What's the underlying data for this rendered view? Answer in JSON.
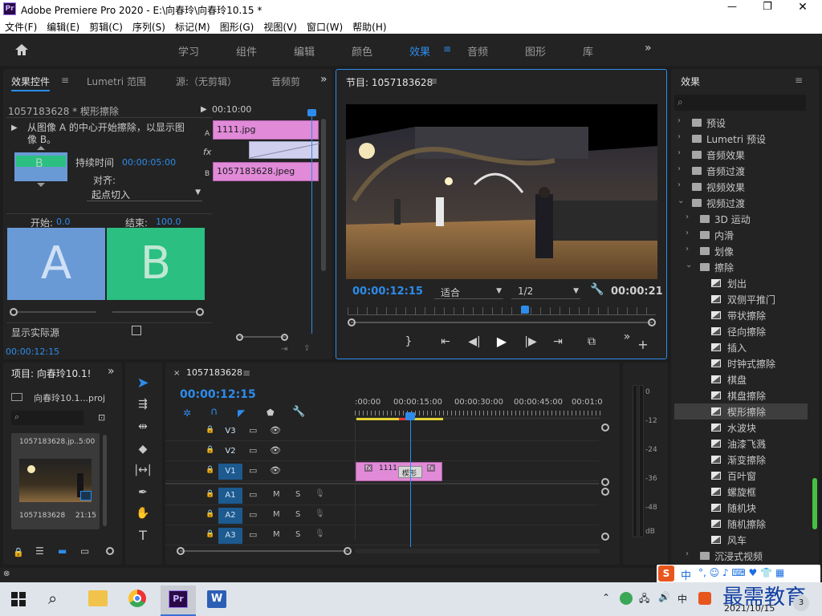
{
  "titlebar": {
    "app_icon": "Pr",
    "title": "Adobe Premiere Pro 2020 - E:\\向春玲\\向春玲10.15 *",
    "min": "—",
    "max": "❐",
    "close": "✕"
  },
  "menu": [
    "文件(F)",
    "编辑(E)",
    "剪辑(C)",
    "序列(S)",
    "标记(M)",
    "图形(G)",
    "视图(V)",
    "窗口(W)",
    "帮助(H)"
  ],
  "workspaces": [
    "学习",
    "组件",
    "编辑",
    "颜色",
    "效果",
    "音频",
    "图形",
    "库"
  ],
  "active_workspace": "效果",
  "effect_controls": {
    "tabs": [
      "效果控件",
      "Lumetri 范围",
      "源:（无剪辑）",
      "音频剪"
    ],
    "clip": "1057183628 * 楔形擦除",
    "time_head": "00:10:00",
    "description": "从图像 A 的中心开始擦除，以显示图像 B。",
    "duration_label": "持续时间",
    "duration": "00:00:05:00",
    "align_label": "对齐:",
    "align_value": "起点切入",
    "start_label": "开始:",
    "start_value": "0.0",
    "end_label": "结束:",
    "end_value": "100.0",
    "a": "A",
    "b": "B",
    "preview_letter": "B",
    "show_actual": "显示实际源",
    "clip_a": "1111.jpg",
    "clip_b": "1057183628.jpeg",
    "track_a": "A",
    "track_b": "B",
    "fx": "fx",
    "timecode": "00:00:12:15"
  },
  "program": {
    "title": "节目: 1057183628",
    "timecode": "00:00:12:15",
    "fit": "适合",
    "quality": "1/2",
    "duration": "00:00:21"
  },
  "project": {
    "title": "项目: 向春玲10.1!",
    "file": "向春玲10.1...proj",
    "thumb_name": "1057183628.jp...",
    "thumb_dur": "5:00",
    "item_name": "1057183628",
    "item_dur": "21:15"
  },
  "timeline": {
    "seq": "1057183628",
    "timecode": "00:00:12:15",
    "ruler": [
      ":00:00",
      "00:00:15:00",
      "00:00:30:00",
      "00:00:45:00",
      "00:01:0"
    ],
    "video_tracks": [
      "V3",
      "V2",
      "V1"
    ],
    "audio_tracks": [
      "A1",
      "A2",
      "A3"
    ],
    "m": "M",
    "s": "S",
    "clip1": "1111",
    "transition": "楔形",
    "meter_ticks": [
      "0",
      "-12",
      "-24",
      "-36",
      "-48",
      "dB"
    ]
  },
  "effects": {
    "title": "效果",
    "top": [
      "预设",
      "Lumetri 预设",
      "音频效果",
      "音频过渡",
      "视频效果",
      "视频过渡"
    ],
    "sub": [
      "3D 运动",
      "内滑",
      "划像",
      "擦除"
    ],
    "wipes": [
      "划出",
      "双侧平推门",
      "带状擦除",
      "径向擦除",
      "插入",
      "时钟式擦除",
      "棋盘",
      "棋盘擦除",
      "楔形擦除",
      "水波块",
      "油漆飞溅",
      "渐变擦除",
      "百叶窗",
      "螺旋框",
      "随机块",
      "随机擦除",
      "风车"
    ],
    "selected": "楔形擦除",
    "bottom": "沉浸式视频"
  },
  "taskbar": {
    "date": "2021/10/15",
    "time": "",
    "ime": "中",
    "notif": "3",
    "watermark": "最需教育"
  },
  "colors": {
    "accent": "#2d8ceb",
    "clip_pink": "#e08ad8",
    "a_blue": "#6a9ad6",
    "b_green": "#2bbf82"
  }
}
